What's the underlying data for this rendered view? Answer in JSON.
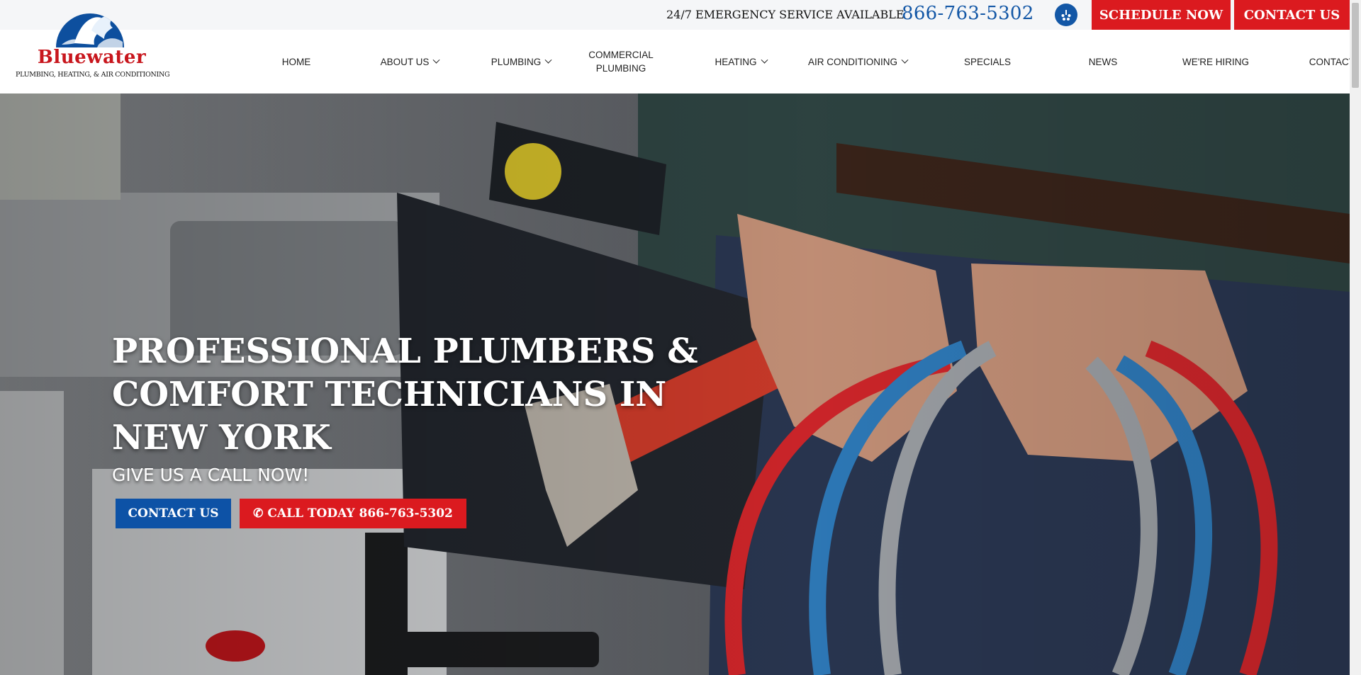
{
  "topbar": {
    "emergency_text": "24/7 EMERGENCY SERVICE AVAILABLE",
    "phone": "866-763-5302",
    "yelp_icon": "yelp-icon",
    "schedule_label": "SCHEDULE NOW",
    "contact_label": "CONTACT US"
  },
  "logo": {
    "name": "Bluewater",
    "tagline": "PLUMBING, HEATING, & AIR CONDITIONING"
  },
  "nav": {
    "items": [
      {
        "label": "HOME",
        "dropdown": false
      },
      {
        "label": "ABOUT US",
        "dropdown": true
      },
      {
        "label": "PLUMBING",
        "dropdown": true
      },
      {
        "label": "COMMERCIAL PLUMBING",
        "dropdown": false
      },
      {
        "label": "HEATING",
        "dropdown": true
      },
      {
        "label": "AIR CONDITIONING",
        "dropdown": true
      },
      {
        "label": "SPECIALS",
        "dropdown": false
      },
      {
        "label": "NEWS",
        "dropdown": false
      },
      {
        "label": "WE'RE HIRING",
        "dropdown": false
      },
      {
        "label": "CONTACT US",
        "dropdown": false
      }
    ]
  },
  "hero": {
    "title": "PROFESSIONAL PLUMBERS & COMFORT TECHNICIANS IN NEW YORK",
    "subtitle": "GIVE US A CALL NOW!",
    "contact_label": "CONTACT US",
    "call_label": "CALL TODAY 866-763-5302"
  },
  "colors": {
    "brand_blue": "#1357a6",
    "brand_red": "#db1a1f"
  }
}
